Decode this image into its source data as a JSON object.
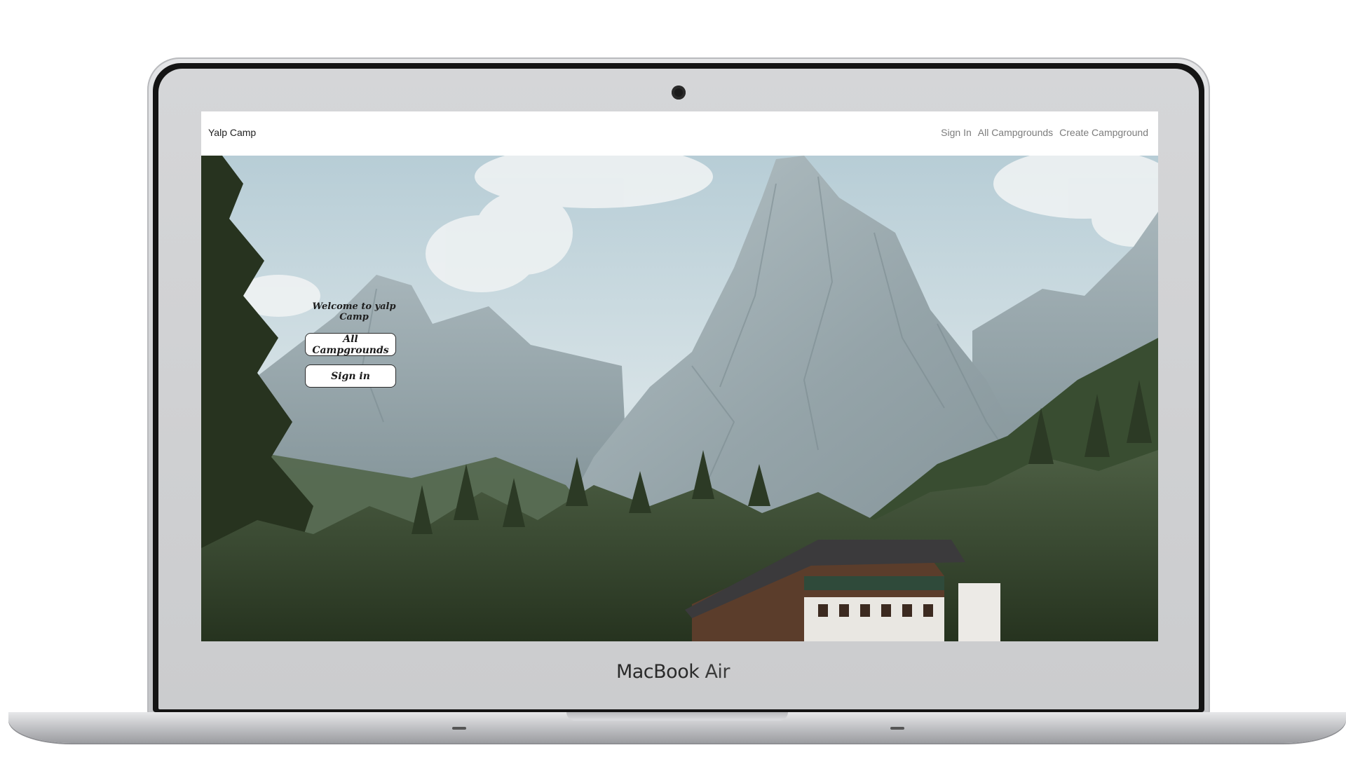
{
  "device": {
    "brand_main": "MacBook",
    "brand_sub": "Air"
  },
  "navbar": {
    "brand": "Yalp Camp",
    "links": [
      {
        "label": "Sign In"
      },
      {
        "label": "All Campgrounds"
      },
      {
        "label": "Create Campground"
      }
    ]
  },
  "hero": {
    "welcome_text": "Welcome to yalp Camp",
    "buttons": [
      {
        "label": "All Campgrounds"
      },
      {
        "label": "Sign in"
      }
    ]
  },
  "colors": {
    "sky": "#c9d9df",
    "rock": "#a9b6ba",
    "forest": "#2f3d2a",
    "button_border": "#2b2b2b"
  }
}
